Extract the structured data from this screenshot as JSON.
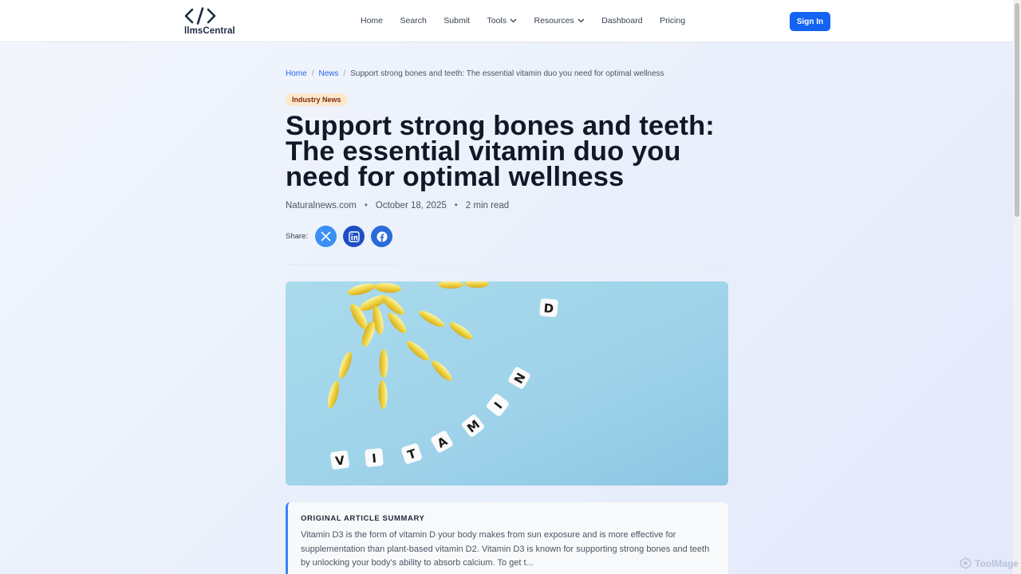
{
  "header": {
    "logo_text": "llmsCentral",
    "nav": [
      "Home",
      "Search",
      "Submit",
      "Tools",
      "Resources",
      "Dashboard",
      "Pricing"
    ],
    "sign_in": "Sign In"
  },
  "breadcrumb": {
    "home": "Home",
    "sep": "/",
    "news": "News",
    "current": "Support strong bones and teeth: The essential vitamin duo you need for optimal wellness"
  },
  "article": {
    "category": "Industry News",
    "title": "Support strong bones and teeth: The essential vitamin duo you need for optimal wellness",
    "source": "Naturalnews.com",
    "bullet": "•",
    "date": "October 18, 2025",
    "read_time": "2 min read",
    "share_label": "Share:",
    "image_letters": [
      "V",
      "I",
      "T",
      "A",
      "M",
      "I",
      "N",
      "D"
    ]
  },
  "summary": {
    "heading": "ORIGINAL ARTICLE SUMMARY",
    "text": "Vitamin D3 is the form of vitamin D your body makes from sun exposure and is more effective for supplementation than plant-based vitamin D2. Vitamin D3 is known for supporting strong bones and teeth by unlocking your body's ability to absorb calcium. To get t..."
  },
  "watermark": "ToolMage",
  "colors": {
    "accent": "#1463f3",
    "badge_bg": "#fde8cc",
    "badge_text": "#7c2d12",
    "summary_border": "#3b82f6"
  }
}
